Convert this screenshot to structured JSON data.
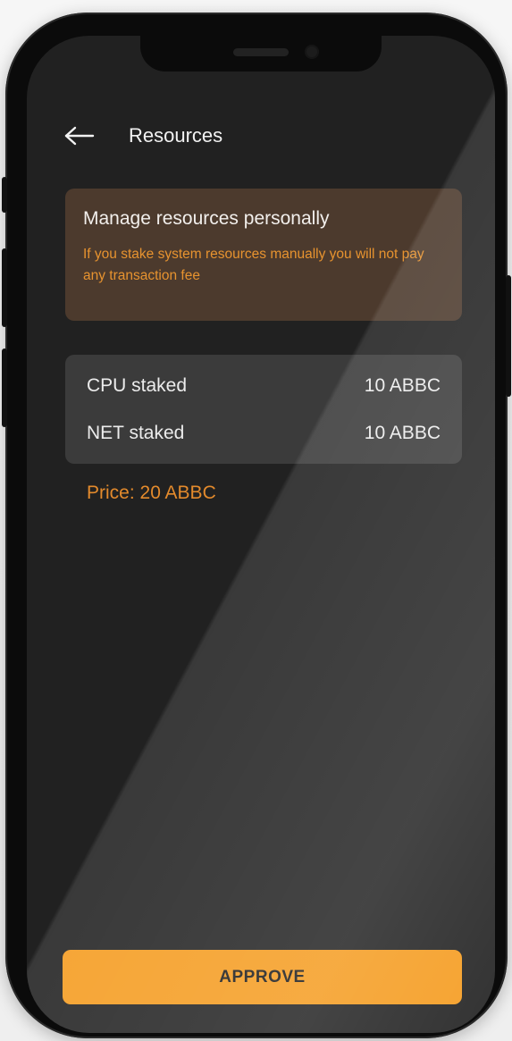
{
  "header": {
    "title": "Resources",
    "back_icon": "arrow-left-icon"
  },
  "info_card": {
    "title": "Manage resources personally",
    "description": "If you stake system resources manually you will not pay any transaction fee"
  },
  "stake": {
    "rows": [
      {
        "label": "CPU staked",
        "value": "10 ABBC"
      },
      {
        "label": "NET staked",
        "value": "10 ABBC"
      }
    ]
  },
  "price": {
    "text": "Price: 20 ABBC"
  },
  "actions": {
    "approve_label": "APPROVE"
  },
  "colors": {
    "accent": "#f59b1e",
    "warning_text": "#e7932f",
    "screen_bg": "#212121",
    "card_bg": "#3b3b3b",
    "info_card_bg": "#4c3a2d"
  }
}
